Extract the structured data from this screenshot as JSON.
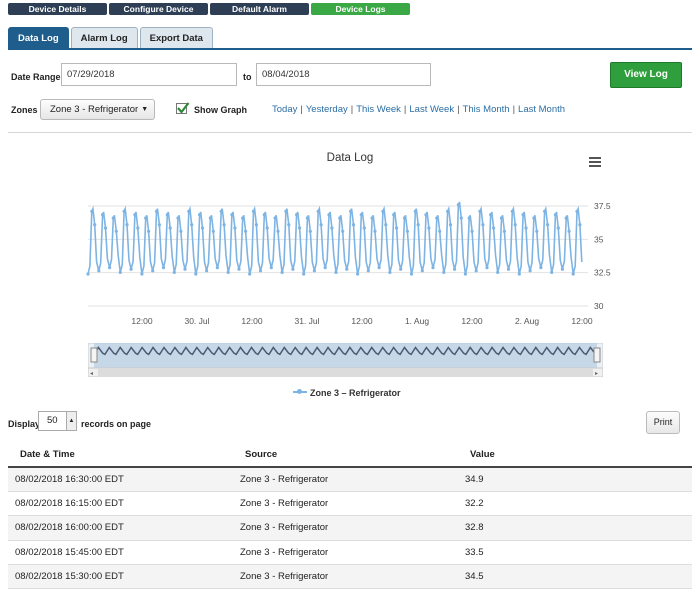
{
  "top_nav": [
    {
      "label": "Device Details",
      "active": false
    },
    {
      "label": "Configure Device",
      "active": false
    },
    {
      "label": "Default Alarm Delivery",
      "active": false
    },
    {
      "label": "Device Logs",
      "active": true
    }
  ],
  "tabs": [
    {
      "label": "Data Log",
      "active": true
    },
    {
      "label": "Alarm Log",
      "active": false
    },
    {
      "label": "Export Data",
      "active": false
    }
  ],
  "filters": {
    "date_range_label": "Date Range",
    "start_date": "07/29/2018",
    "to_label": "to",
    "end_date": "08/04/2018",
    "view_log_label": "View Log",
    "zones_label": "Zones",
    "zone_selected": "Zone 3 - Refrigerator",
    "show_graph_label": "Show Graph",
    "show_graph_checked": true,
    "quick_ranges": [
      "Today",
      "Yesterday",
      "This Week",
      "Last Week",
      "This Month",
      "Last Month"
    ]
  },
  "chart_data": {
    "type": "line",
    "title": "Data Log",
    "x_tick_labels": [
      "12:00",
      "30. Jul",
      "12:00",
      "31. Jul",
      "12:00",
      "1. Aug",
      "12:00",
      "2. Aug",
      "12:00"
    ],
    "y_tick_labels": [
      "37.5",
      "35",
      "32.5",
      "30"
    ],
    "ylim": [
      30,
      37.5
    ],
    "y_axis_side": "right",
    "grid": true,
    "series": [
      {
        "name": "Zone 3 – Refrigerator",
        "color": "#7eb4e3",
        "cycles_per_day": 11,
        "low": 32.4,
        "high": 37.3,
        "peak": 37.8,
        "values": [
          34.9,
          32.2,
          32.8,
          33.5,
          34.5
        ]
      }
    ],
    "legend_position": "bottom-center",
    "navigator": true
  },
  "table_controls": {
    "display_label": "Display",
    "page_size": "50",
    "records_label": "records on page",
    "print_label": "Print"
  },
  "table": {
    "headers": [
      "Date & Time",
      "Source",
      "Value"
    ],
    "rows": [
      [
        "08/02/2018 16:30:00 EDT",
        "Zone 3 - Refrigerator",
        "34.9"
      ],
      [
        "08/02/2018 16:15:00 EDT",
        "Zone 3 - Refrigerator",
        "32.2"
      ],
      [
        "08/02/2018 16:00:00 EDT",
        "Zone 3 - Refrigerator",
        "32.8"
      ],
      [
        "08/02/2018 15:45:00 EDT",
        "Zone 3 - Refrigerator",
        "33.5"
      ],
      [
        "08/02/2018 15:30:00 EDT",
        "Zone 3 - Refrigerator",
        "34.5"
      ]
    ]
  }
}
